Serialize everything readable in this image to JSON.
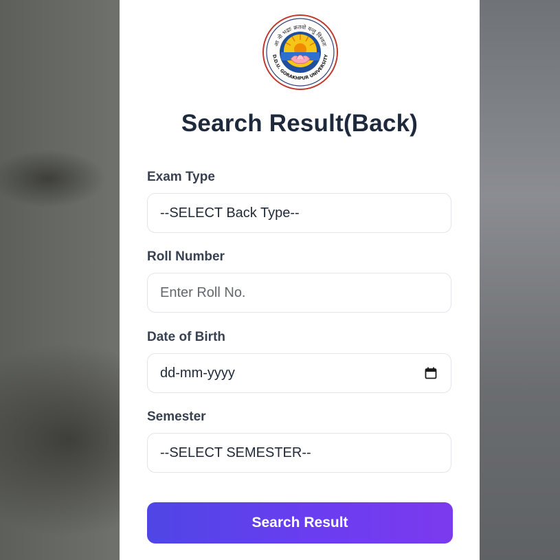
{
  "logo": {
    "arc_text": "आ नो भद्राः क्रतवो यन्तु विश्वतः",
    "ring_text": "D.D.U. GORAKHPUR UNIVERSITY"
  },
  "page_title": "Search Result(Back)",
  "form": {
    "exam_type": {
      "label": "Exam Type",
      "value": "--SELECT Back Type--"
    },
    "roll_number": {
      "label": "Roll Number",
      "placeholder": "Enter Roll No."
    },
    "date_of_birth": {
      "label": "Date of Birth",
      "value": "dd-mm-yyyy",
      "icon": "calendar-icon"
    },
    "semester": {
      "label": "Semester",
      "value": "--SELECT SEMESTER--"
    },
    "submit_label": "Search Result"
  },
  "colors": {
    "button_start": "#4f46e5",
    "button_end": "#7c3aed",
    "title": "#1e293b"
  }
}
